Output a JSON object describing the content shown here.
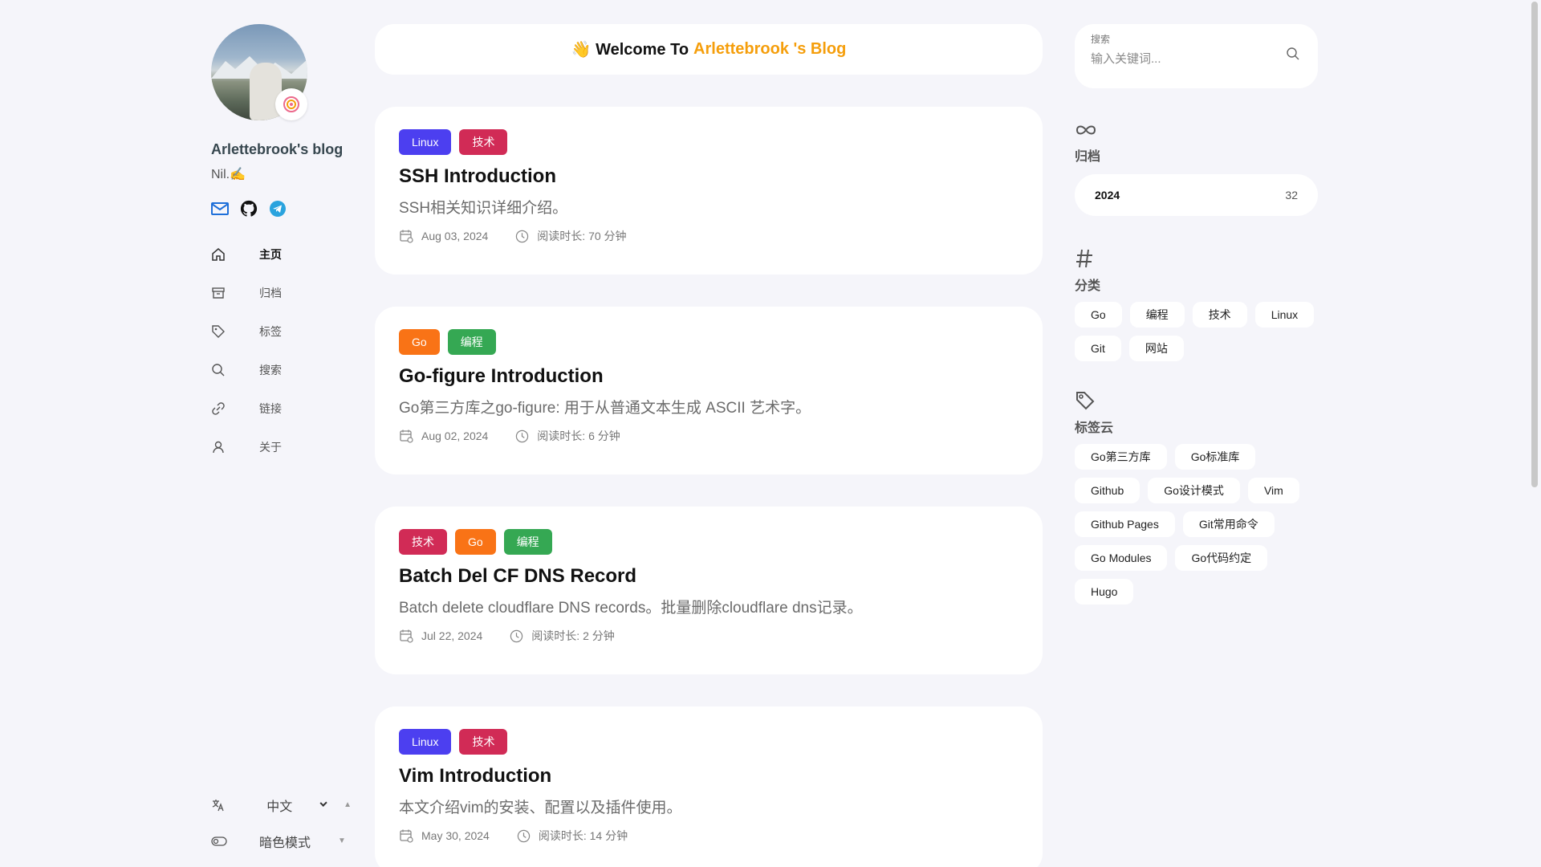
{
  "sidebar": {
    "blog_title": "Arlettebrook's blog",
    "subtitle": "Nil.✍️",
    "social": [
      "mail-icon",
      "github-icon",
      "telegram-icon"
    ],
    "nav": [
      {
        "label": "主页",
        "icon": "home-icon",
        "active": true
      },
      {
        "label": "归档",
        "icon": "archive-icon"
      },
      {
        "label": "标签",
        "icon": "tag-icon"
      },
      {
        "label": "搜索",
        "icon": "search-icon"
      },
      {
        "label": "链接",
        "icon": "link-icon"
      },
      {
        "label": "关于",
        "icon": "user-icon"
      }
    ],
    "language": "中文",
    "theme_mode": "暗色模式"
  },
  "main": {
    "welcome_prefix": "👋 Welcome To",
    "welcome_name": "Arlettebrook 's Blog",
    "posts": [
      {
        "tags": [
          "Linux",
          "技术"
        ],
        "title": "SSH Introduction",
        "desc": "SSH相关知识详细介绍。",
        "date": "Aug 03, 2024",
        "read": "阅读时长: 70 分钟"
      },
      {
        "tags": [
          "Go",
          "编程"
        ],
        "title": "Go-figure Introduction",
        "desc": "Go第三方库之go-figure: 用于从普通文本生成 ASCII 艺术字。",
        "date": "Aug 02, 2024",
        "read": "阅读时长: 6 分钟"
      },
      {
        "tags": [
          "技术",
          "Go",
          "编程"
        ],
        "title": "Batch Del CF DNS Record",
        "desc": "Batch delete cloudflare DNS records。批量删除cloudflare dns记录。",
        "date": "Jul 22, 2024",
        "read": "阅读时长: 2 分钟"
      },
      {
        "tags": [
          "Linux",
          "技术"
        ],
        "title": "Vim Introduction",
        "desc": "本文介绍vim的安装、配置以及插件使用。",
        "date": "May 30, 2024",
        "read": "阅读时长: 14 分钟"
      }
    ]
  },
  "right": {
    "search_label": "搜索",
    "search_placeholder": "输入关键词...",
    "archive_title": "归档",
    "archive": [
      {
        "year": "2024",
        "count": "32"
      }
    ],
    "categories_title": "分类",
    "categories": [
      "Go",
      "编程",
      "技术",
      "Linux",
      "Git",
      "网站"
    ],
    "tagcloud_title": "标签云",
    "tagcloud": [
      "Go第三方库",
      "Go标准库",
      "Github",
      "Go设计模式",
      "Vim",
      "Github Pages",
      "Git常用命令",
      "Go Modules",
      "Go代码约定",
      "Hugo"
    ]
  },
  "colors": {
    "accent": "#f59e0b",
    "tag_linux": "#4c3ff0",
    "tag_tech": "#d12b56",
    "tag_go": "#f97316",
    "tag_code": "#35a853"
  }
}
